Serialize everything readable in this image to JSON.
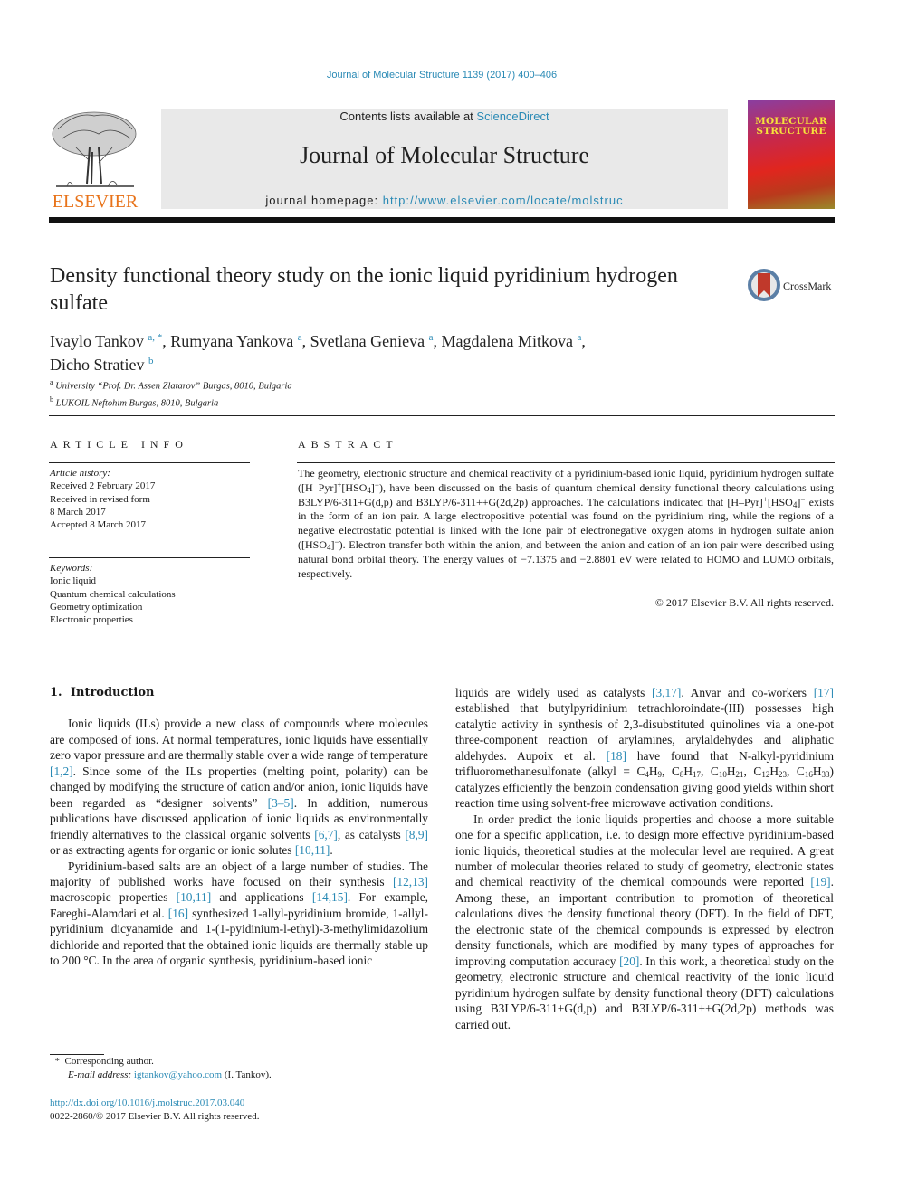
{
  "header": {
    "citation": "Journal of Molecular Structure 1139 (2017) 400–406",
    "publisher_logo_icon": "elsevier-tree-icon",
    "publisher_name": "ELSEVIER",
    "contents_prefix": "Contents lists available at ",
    "contents_link": "ScienceDirect",
    "journal_name": "Journal of Molecular Structure",
    "homepage_prefix": "journal homepage: ",
    "homepage_link": "http://www.elsevier.com/locate/molstruc",
    "cover_title_line1": "MOLECULAR",
    "cover_title_line2": "STRUCTURE"
  },
  "article": {
    "title": "Density functional theory study on the ionic liquid pyridinium hydrogen sulfate",
    "crossmark_label": "CrossMark",
    "authors": [
      {
        "name": "Ivaylo Tankov",
        "sup": "a, *",
        "sep": ", "
      },
      {
        "name": "Rumyana Yankova",
        "sup": "a",
        "sep": ", "
      },
      {
        "name": "Svetlana Genieva",
        "sup": "a",
        "sep": ", "
      },
      {
        "name": "Magdalena Mitkova",
        "sup": "a",
        "sep": ","
      },
      {
        "name": "Dicho Stratiev",
        "sup": "b",
        "sep": ""
      }
    ],
    "affiliations": [
      {
        "sup": "a",
        "text": "University “Prof. Dr. Assen Zlatarov” Burgas, 8010, Bulgaria"
      },
      {
        "sup": "b",
        "text": "LUKOIL Neftohim Burgas, 8010, Bulgaria"
      }
    ]
  },
  "article_info": {
    "heading": "ARTICLE INFO",
    "history_label": "Article history:",
    "history": [
      "Received 2 February 2017",
      "Received in revised form",
      "8 March 2017",
      "Accepted 8 March 2017"
    ],
    "keywords_label": "Keywords:",
    "keywords": [
      "Ionic liquid",
      "Quantum chemical calculations",
      "Geometry optimization",
      "Electronic properties"
    ]
  },
  "abstract": {
    "heading": "ABSTRACT",
    "s1": "The geometry, electronic structure and chemical reactivity of a pyridinium-based ionic liquid, pyridinium hydrogen sulfate ([H–Pyr]",
    "s2": "[HSO",
    "s3": "]",
    "s4": "), have been discussed on the basis of quantum chemical density functional theory calculations using B3LYP/6-311+G(d,p) and B3LYP/6-311++G(2d,2p) approaches. The calculations indicated that [H–Pyr]",
    "s5": "[HSO",
    "s6": "]",
    "s7": " exists in the form of an ion pair. A large electropositive potential was found on the pyridinium ring, while the regions of a negative electrostatic potential is linked with the lone pair of electronegative oxygen atoms in hydrogen sulfate anion ([HSO",
    "s8": "]",
    "s9": "). Electron transfer both within the anion, and between the anion and cation of an ion pair were described using natural bond orbital theory. The energy values of −7.1375 and −2.8801 eV were related to HOMO and LUMO orbitals, respectively.",
    "plus": "+",
    "minus": "−",
    "four": "4",
    "copyright": "© 2017 Elsevier B.V. All rights reserved."
  },
  "introduction": {
    "number": "1.",
    "heading": "Introduction",
    "p1": {
      "a": "Ionic liquids (ILs) provide a new class of compounds where molecules are composed of ions. At normal temperatures, ionic liquids have essentially zero vapor pressure and are thermally stable over a wide range of temperature ",
      "r1": "[1,2]",
      "b": ". Since some of the ILs properties (melting point, polarity) can be changed by modifying the structure of cation and/or anion, ionic liquids have been regarded as “designer solvents” ",
      "r2": "[3–5]",
      "c": ". In addition, numerous publications have discussed application of ionic liquids as environmentally friendly alternatives to the classical organic solvents ",
      "r3": "[6,7]",
      "d": ", as catalysts ",
      "r4": "[8,9]",
      "e": " or as extracting agents for organic or ionic solutes ",
      "r5": "[10,11]",
      "f": "."
    },
    "p2": {
      "a": "Pyridinium-based salts are an object of a large number of studies. The majority of published works have focused on their synthesis ",
      "r1": "[12,13]",
      "b": " macroscopic properties ",
      "r2": "[10,11]",
      "c": " and applications ",
      "r3": "[14,15]",
      "d": ". For example, Fareghi-Alamdari et al. ",
      "r4": "[16]",
      "e": " synthesized 1-allyl-pyridinium bromide, 1-allyl-pyridinium dicyanamide and 1-(1-pyidinium-l-ethyl)-3-methylimidazolium dichloride and reported that the obtained ionic liquids are thermally stable up to 200 °C. In the area of organic synthesis, pyridinium-based ionic liquids are widely used as catalysts ",
      "r5": "[3,17]",
      "f": ". Anvar and co-workers ",
      "r6": "[17]",
      "g": " established that butylpyridinium tetrachloroindate-(III) possesses high catalytic activity in synthesis of 2,3-disubstituted quinolines via a one-pot three-component reaction of arylamines, arylaldehydes and aliphatic aldehydes. Aupoix et al. ",
      "r7": "[18]",
      "h": " have found that N-alkyl-pyridinium trifluoromethanesulfonate (alkyl = C",
      "f1": "4",
      "h1": "H",
      "f2": "9",
      "c2": ", C",
      "f3": "8",
      "h3": "H",
      "f4": "17",
      "c4": ", C",
      "f5": "10",
      "h5": "H",
      "f6": "21",
      "c6": ", C",
      "f7": "12",
      "h7": "H",
      "f8": "23",
      "c8": ", C",
      "f9": "16",
      "h9": "H",
      "f10": "33",
      "i": ") catalyzes efficiently the benzoin condensation giving good yields within short reaction time using solvent-free microwave activation conditions."
    },
    "p3": {
      "a": "In order predict the ionic liquids properties and choose a more suitable one for a specific application, i.e. to design more effective pyridinium-based ionic liquids, theoretical studies at the molecular level are required. A great number of molecular theories related to study of geometry, electronic states and chemical reactivity of the chemical compounds were reported ",
      "r1": "[19]",
      "b": ". Among these, an important contribution to promotion of theoretical calculations dives the density functional theory (DFT). In the field of DFT, the electronic state of the chemical compounds is expressed by electron density functionals, which are modified by many types of approaches for improving computation accuracy ",
      "r2": "[20]",
      "c": ". In this work, a theoretical study on the geometry, electronic structure and chemical reactivity of the ionic liquid pyridinium hydrogen sulfate by density functional theory (DFT) calculations using B3LYP/6-311+G(d,p) and B3LYP/6-311++G(2d,2p) methods was carried out."
    }
  },
  "footnotes": {
    "star": "*",
    "corresponding": "Corresponding author.",
    "email_label": "E-mail address: ",
    "email": "igtankov@yahoo.com",
    "email_owner": " (I. Tankov).",
    "doi": "http://dx.doi.org/10.1016/j.molstruc.2017.03.040",
    "issn_line": "0022-2860/© 2017 Elsevier B.V. All rights reserved."
  },
  "colors": {
    "link": "#2a8ab5",
    "elsevier_orange": "#e8731a",
    "masthead_bg": "#e9e9e9",
    "cover_title": "#f6e23a"
  }
}
